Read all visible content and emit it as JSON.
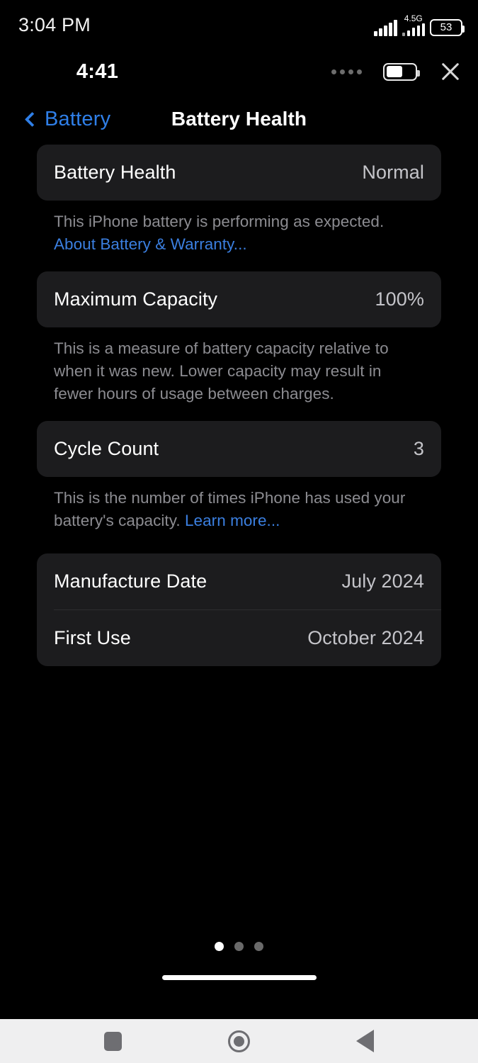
{
  "android_status": {
    "clock": "3:04 PM",
    "network_label": "4.5G",
    "battery_percent": "53",
    "signal_icon": "signal-bars-icon",
    "battery_icon": "battery-icon"
  },
  "mini_window": {
    "time": "4:41",
    "signal_dots_icon": "signal-dots-icon",
    "battery_icon": "battery-icon",
    "close_icon": "close-icon"
  },
  "nav": {
    "back_label": "Battery",
    "back_icon": "chevron-left-icon",
    "title": "Battery Health"
  },
  "sections": {
    "battery_health": {
      "label": "Battery Health",
      "value": "Normal",
      "note_text": "This iPhone battery is performing as expected. ",
      "note_link": "About Battery & Warranty..."
    },
    "maximum_capacity": {
      "label": "Maximum Capacity",
      "value": "100%",
      "note_text": "This is a measure of battery capacity relative to when it was new. Lower capacity may result in fewer hours of usage between charges."
    },
    "cycle_count": {
      "label": "Cycle Count",
      "value": "3",
      "note_text": "This is the number of times iPhone has used your battery's capacity. ",
      "note_link": "Learn more..."
    },
    "dates": {
      "manufacture_label": "Manufacture Date",
      "manufacture_value": "July 2024",
      "first_use_label": "First Use",
      "first_use_value": "October 2024"
    }
  },
  "page_indicator": {
    "total": 3,
    "active_index": 0
  },
  "android_nav": {
    "recents_icon": "square-recents-icon",
    "home_icon": "circle-home-icon",
    "back_icon": "triangle-back-icon"
  },
  "colors": {
    "background": "#000000",
    "card": "#1c1c1e",
    "accent_blue": "#2f7fe8",
    "link_blue": "#3b7fe0",
    "secondary_text": "#8c8c91",
    "value_text": "#c4c4c9",
    "nav_bar": "#efeff0",
    "nav_icon": "#6e6e72"
  }
}
